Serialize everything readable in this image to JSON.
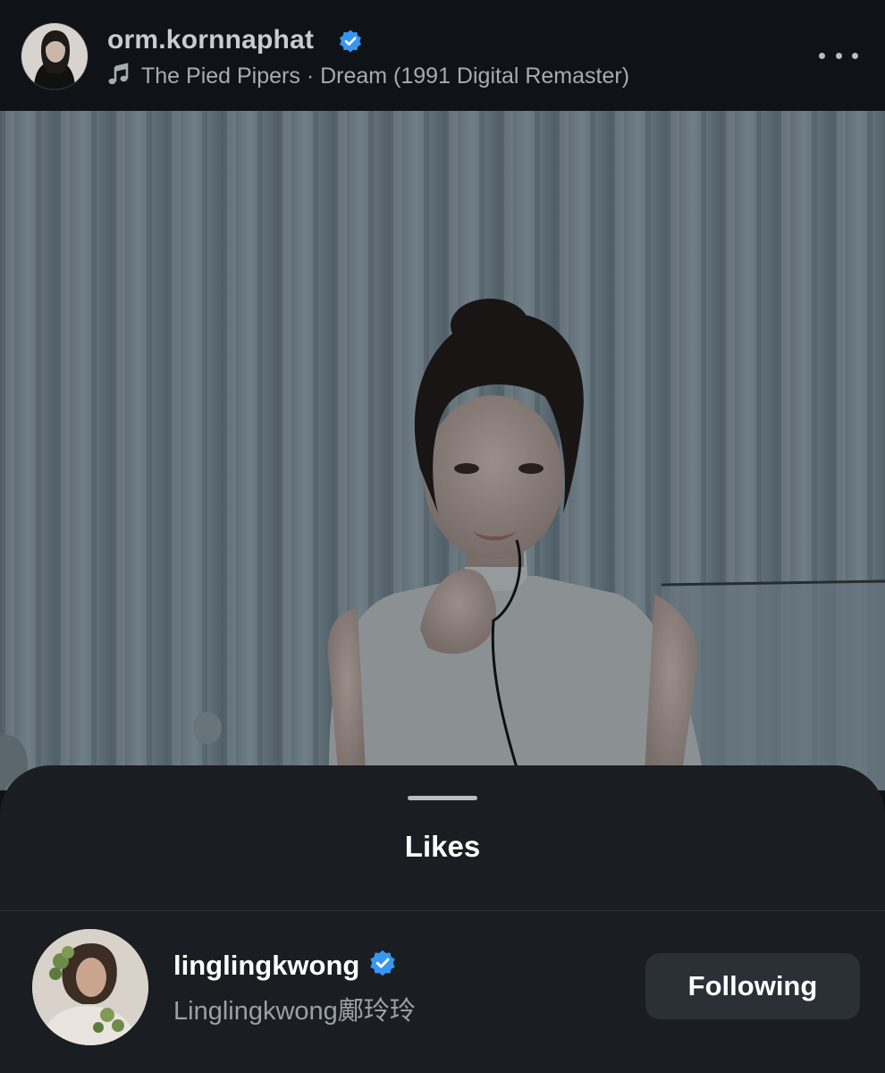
{
  "post": {
    "author": {
      "username": "orm.kornnaphat",
      "verified": true
    },
    "music": {
      "icon": "music-note-icon",
      "text": "The Pied Pipers · Dream (1991 Digital Remaster)"
    },
    "more_icon": "more-horizontal-icon"
  },
  "likes_sheet": {
    "title": "Likes",
    "users": [
      {
        "username": "linglingkwong",
        "verified": true,
        "full_name": "Linglingkwong鄺玲玲",
        "follow_label": "Following"
      }
    ]
  },
  "colors": {
    "verified_badge": "#3797f0",
    "header_bg": "#0f1217",
    "sheet_bg": "#1a1d21",
    "button_bg": "#2b2f36"
  }
}
